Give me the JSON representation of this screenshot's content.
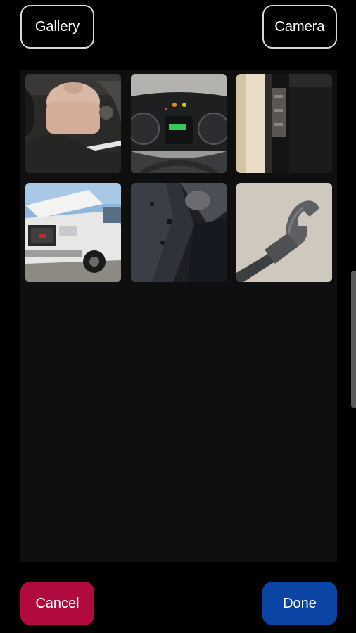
{
  "header": {
    "gallery_label": "Gallery",
    "camera_label": "Camera"
  },
  "photos": [
    {
      "icon": "photo-engine-coolant-reservoir"
    },
    {
      "icon": "photo-dashboard-gauges"
    },
    {
      "icon": "photo-door-hinge"
    },
    {
      "icon": "photo-white-pickup-truck"
    },
    {
      "icon": "photo-undercarriage-part"
    },
    {
      "icon": "photo-wrench-tool"
    }
  ],
  "footer": {
    "cancel_label": "Cancel",
    "done_label": "Done"
  },
  "colors": {
    "background": "#000000",
    "panel": "#0f0f0f",
    "cancel": "#b00a3f",
    "done": "#0a45a5",
    "outline": "#d9d9d9"
  }
}
